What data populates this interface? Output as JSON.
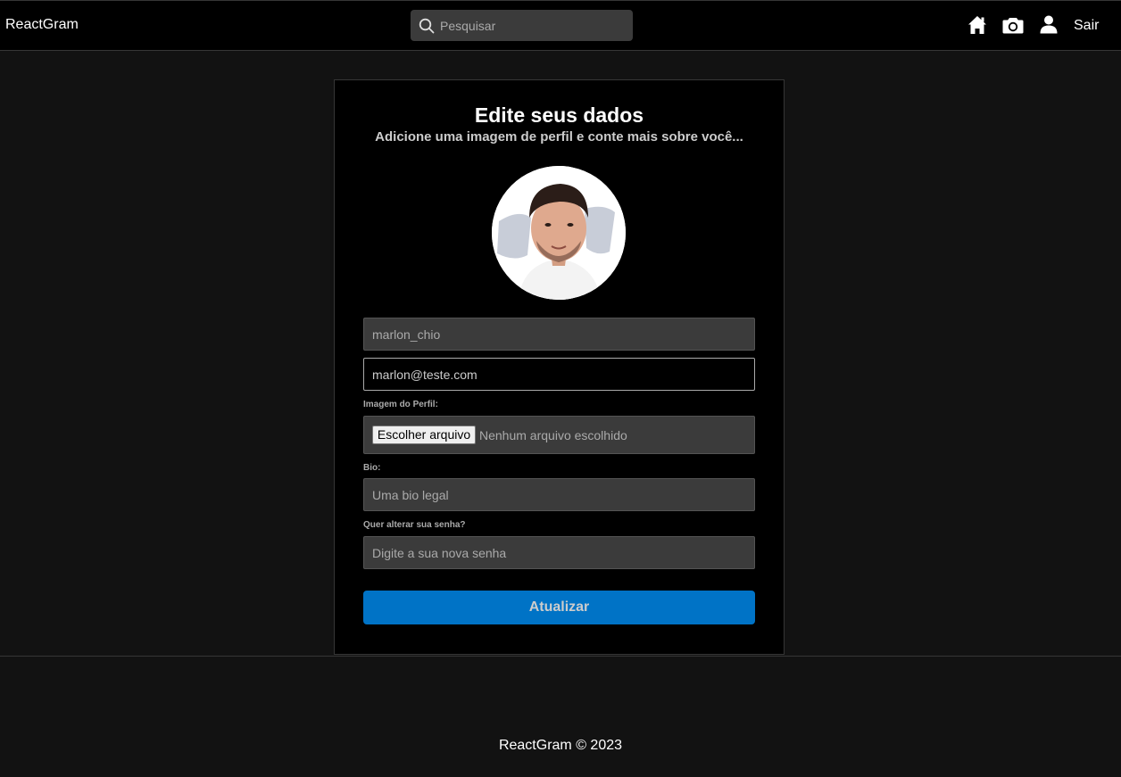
{
  "navbar": {
    "brand": "ReactGram",
    "search_placeholder": "Pesquisar",
    "icons": [
      "home-icon",
      "camera-icon",
      "user-icon"
    ],
    "logout_label": "Sair"
  },
  "edit_profile": {
    "title": "Edite seus dados",
    "subtitle": "Adicione uma imagem de perfil e conte mais sobre você...",
    "name_value": "marlon_chio",
    "email_value": "marlon@teste.com",
    "image_label": "Imagem do Perfil:",
    "file_button_label": "Escolher arquivo",
    "file_status": "Nenhum arquivo escolhido",
    "bio_label": "Bio:",
    "bio_placeholder": "Uma bio legal",
    "password_label": "Quer alterar sua senha?",
    "password_placeholder": "Digite a sua nova senha",
    "submit_label": "Atualizar"
  },
  "footer": {
    "text": "ReactGram © 2023"
  },
  "colors": {
    "background": "#121212",
    "navbar": "#000000",
    "input_bg": "#3b3b3b",
    "accent": "#0073c6"
  }
}
